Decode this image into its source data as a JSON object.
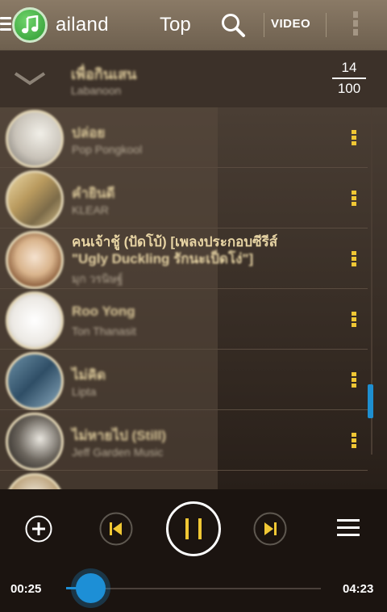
{
  "header": {
    "app_title": "ailand",
    "tab_label": "Top",
    "video_label": "VIDEO",
    "icons": {
      "menu": "hamburger-icon",
      "logo": "music-note-icon",
      "search": "search-icon",
      "overflow": "more-vert-icon"
    }
  },
  "now_playing": {
    "title": "เพื่อกินเสน",
    "artist": "Labanoon",
    "current_index": "14",
    "total": "100"
  },
  "songs": [
    {
      "title": "ปล่อย",
      "artist": "Pop Pongkool"
    },
    {
      "title": "คำยินดี",
      "artist": "KLEAR"
    },
    {
      "title_line1": "คนเจ้าชู้ (ปัดโบ้) [เพลงประกอบซีรีส์",
      "title_line2": "\"Ugly Duckling รักนะเป็ดโง่\"]",
      "artist": "มุก วรนิษฐ์"
    },
    {
      "title": "Roo Yong",
      "artist": "Ton Thanasit"
    },
    {
      "title": "ไม่คิด",
      "artist": "Lipta"
    },
    {
      "title": "ไม่หายไป (Still)",
      "artist": "Jeff Garden Music"
    }
  ],
  "player": {
    "elapsed": "00:25",
    "duration": "04:23",
    "progress": 0.095,
    "is_playing": true
  },
  "colors": {
    "accent": "#f0c734",
    "seek": "#1e90d6",
    "topbar": "#7d6f5c"
  }
}
